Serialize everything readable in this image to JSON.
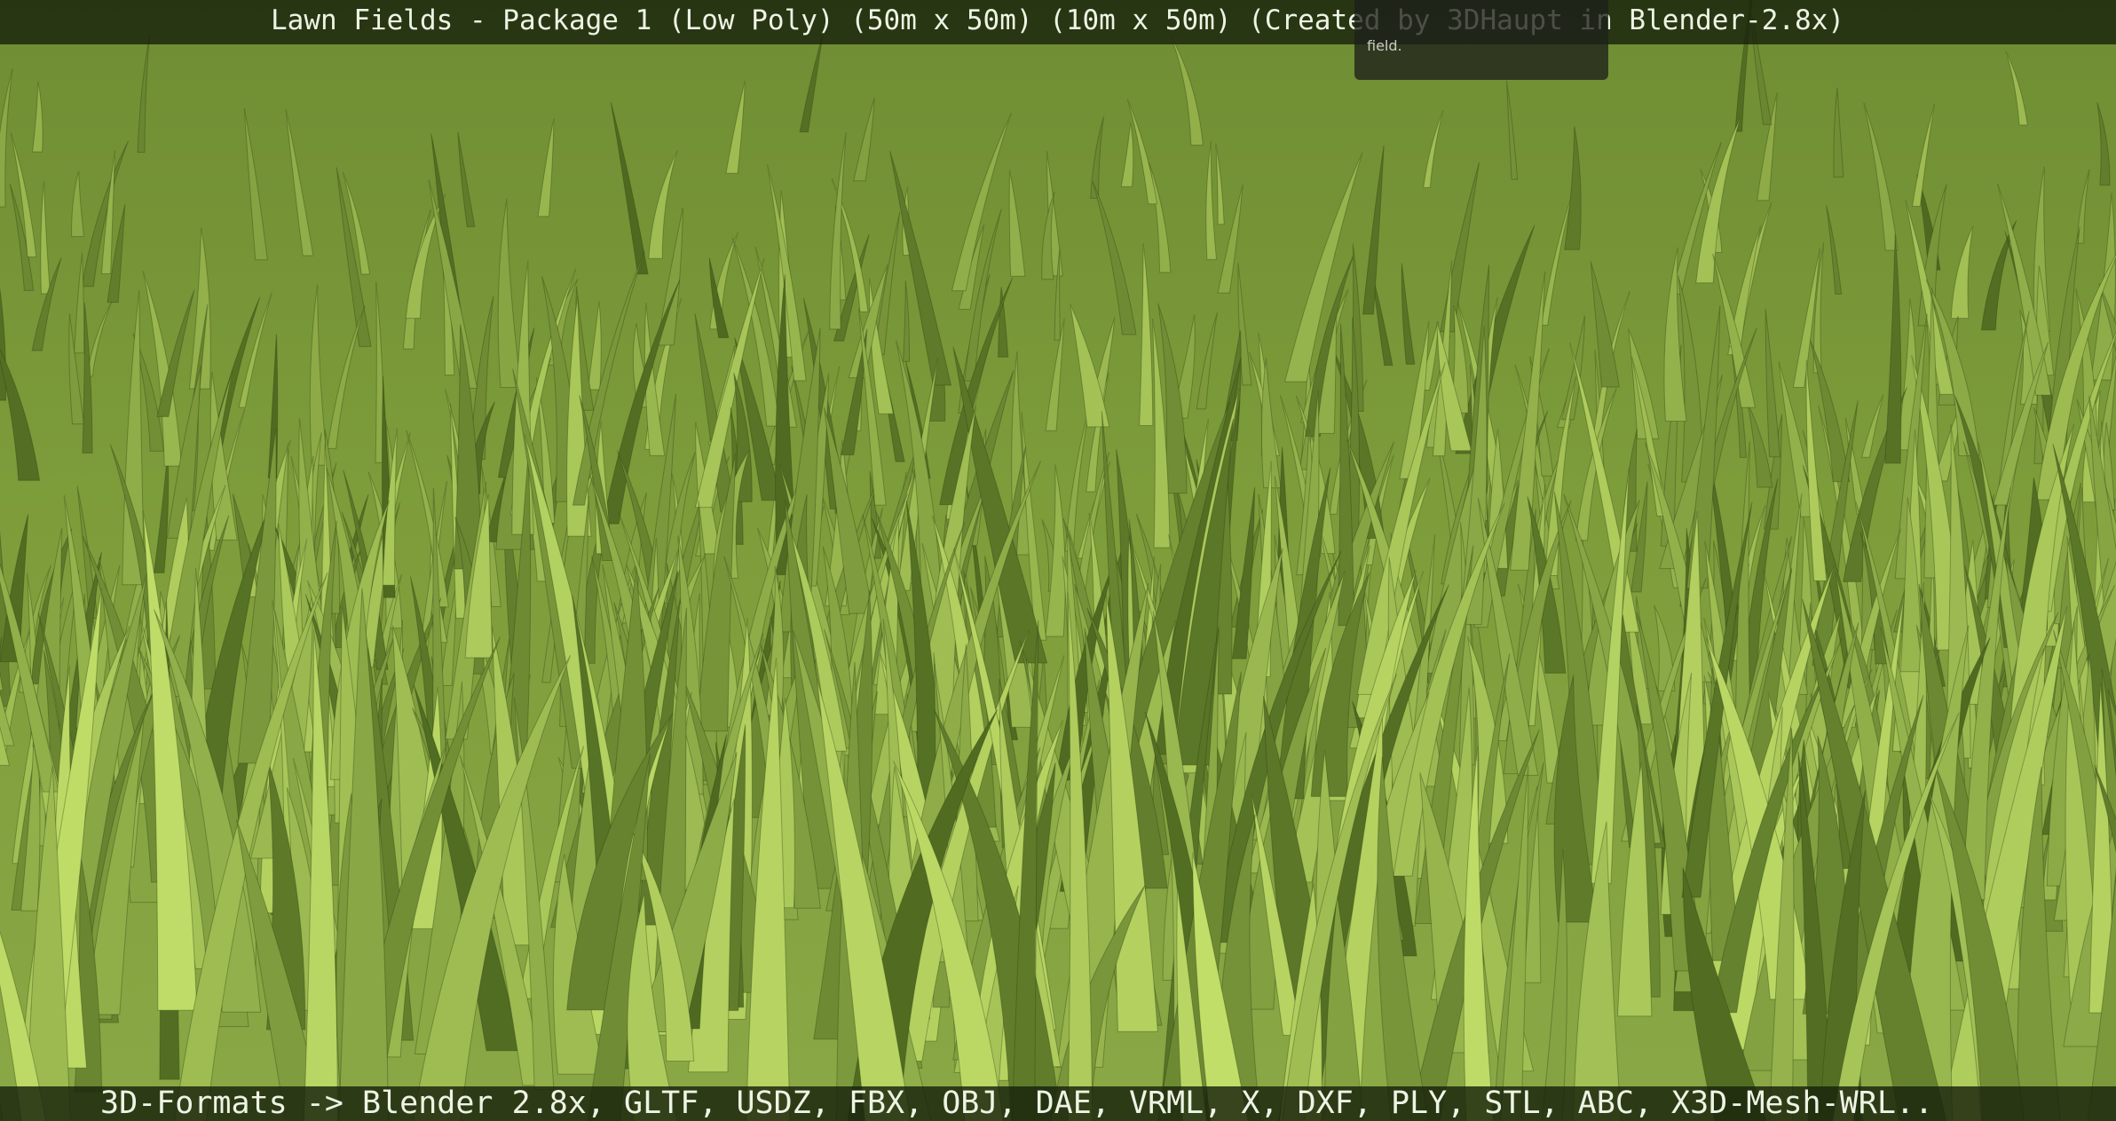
{
  "header": {
    "title": "Lawn Fields - Package 1 (Low Poly) (50m x 50m) (10m x 50m) (Created by 3DHaupt in Blender-2.8x)"
  },
  "tooltip": {
    "text": "field."
  },
  "footer": {
    "formats": "3D-Formats -> Blender 2.8x, GLTF, USDZ, FBX, OBJ, DAE, VRML, X, DXF, PLY, STL, ABC, X3D-Mesh-WRL.."
  },
  "colors": {
    "grass_dark": "#4f6a20",
    "grass_mid": "#8aa845",
    "grass_light": "#c3e06a",
    "bar_bg": "#18220c",
    "bar_text": "#eef3e4"
  }
}
